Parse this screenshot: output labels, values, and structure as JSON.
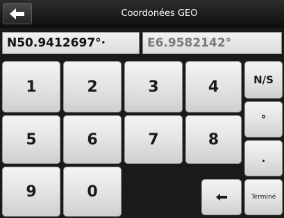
{
  "header": {
    "title": "Coordonées GEO",
    "back_icon": "arrow-left-icon"
  },
  "fields": {
    "latitude": "N50.9412697°·",
    "longitude": "E6.9582142°"
  },
  "keypad": {
    "digits": [
      "1",
      "2",
      "3",
      "4",
      "5",
      "6",
      "7",
      "8",
      "9",
      "0"
    ],
    "ns_label": "N/S",
    "degree_label": "°",
    "decimal_label": ".",
    "backspace_icon": "backspace-arrow-icon",
    "done_label": "Terminé"
  }
}
